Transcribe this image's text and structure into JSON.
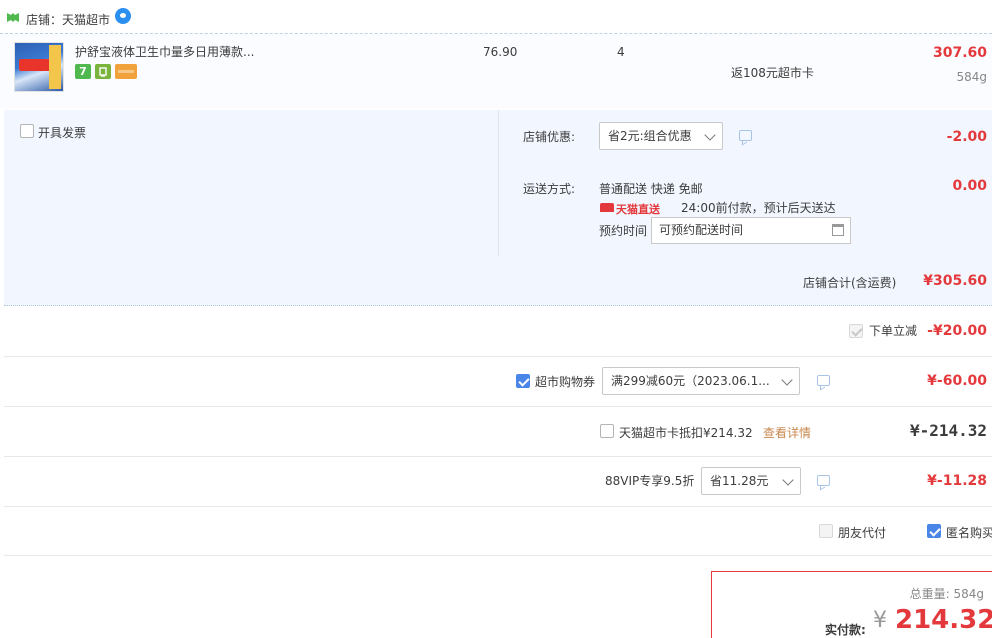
{
  "store": {
    "name": "店铺：天猫超市",
    "icon": "tmall-store-icon",
    "chat_icon": "wangwang-chat-icon"
  },
  "item": {
    "title": "护舒宝液体卫生巾量多日用薄款...",
    "badges": [
      "7",
      "",
      ""
    ],
    "unit_price": "76.90",
    "quantity": "4",
    "rebate": "返108元超市卡",
    "subtotal": "307.60",
    "weight": "584g"
  },
  "invoice": {
    "label": "开具发票",
    "checked": false
  },
  "store_discount": {
    "label": "店铺优惠:",
    "selected": "省2元:组合优惠",
    "amount": "-2.00"
  },
  "shipping": {
    "label": "运送方式:",
    "method": "普通配送 快递 免邮",
    "amount": "0.00",
    "tmall_direct": "天猫直送",
    "promise": "24:00前付款，预计后天送达",
    "reserve_label": "预约时间",
    "reserve_placeholder": "可预约配送时间"
  },
  "store_total": {
    "label": "店铺合计(含运费)",
    "amount": "¥305.60"
  },
  "instant_discount": {
    "label": "下单立减",
    "amount": "-¥20.00",
    "checked": true
  },
  "coupon": {
    "label": "超市购物券",
    "selected": "满299减60元（2023.06.1...",
    "amount": "¥-60.00",
    "checked": true
  },
  "card_deduct": {
    "label": "天猫超市卡抵扣¥214.32",
    "link": "查看详情",
    "amount": "¥-214.32",
    "checked": false
  },
  "vip": {
    "label": "88VIP专享9.5折",
    "selected": "省11.28元",
    "amount": "¥-11.28"
  },
  "options": {
    "friend_pay": "朋友代付",
    "friend_pay_checked": false,
    "anonymous": "匿名购买",
    "anonymous_checked": true
  },
  "payment": {
    "weight": "总重量:  584g",
    "label": "实付款:",
    "currency": "¥",
    "amount": "214.32"
  },
  "colors": {
    "price_red": "#e4393c",
    "panel_bg": "#f2f7ff",
    "accent_blue": "#4a86e8"
  }
}
